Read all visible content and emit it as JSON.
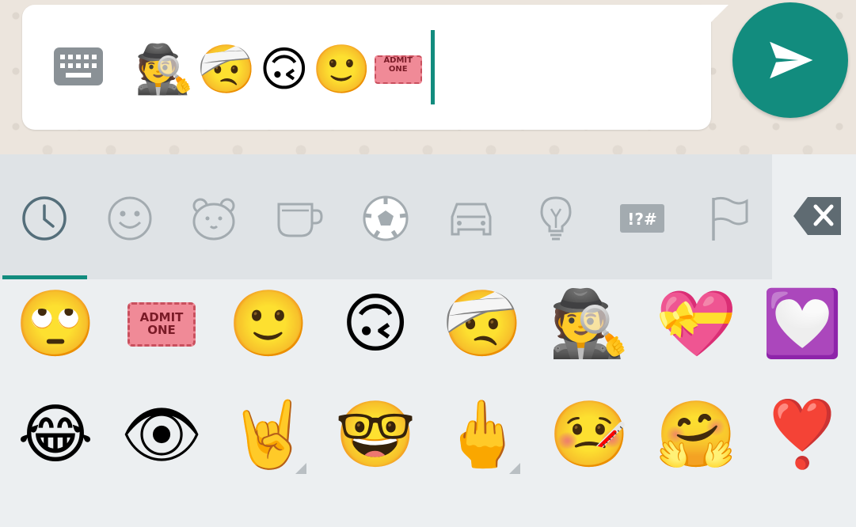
{
  "compose": {
    "typed_emojis": [
      "🕵️",
      "🤕",
      "🙃",
      "🙂"
    ],
    "ticket_text": "ADMIT ONE",
    "keyboard_toggle_icon": "keyboard-icon",
    "send_icon": "send-icon"
  },
  "tabs": [
    {
      "name": "recent",
      "icon": "clock-icon",
      "active": true
    },
    {
      "name": "smileys",
      "icon": "smiley-icon",
      "active": false
    },
    {
      "name": "animals",
      "icon": "bear-icon",
      "active": false
    },
    {
      "name": "food",
      "icon": "cup-icon",
      "active": false
    },
    {
      "name": "activities",
      "icon": "soccer-ball-icon",
      "active": false
    },
    {
      "name": "travel",
      "icon": "car-icon",
      "active": false
    },
    {
      "name": "objects",
      "icon": "lightbulb-icon",
      "active": false
    },
    {
      "name": "symbols",
      "icon": "symbols-icon",
      "label": "!?#",
      "active": false
    },
    {
      "name": "flags",
      "icon": "flag-icon",
      "active": false
    }
  ],
  "grid": {
    "row1": [
      "🙄",
      "ADMIT ONE",
      "🙂",
      "🙃",
      "🤕",
      "🕵️",
      "💝",
      "💟"
    ],
    "row2": [
      "😂",
      "👁",
      "🤘",
      "🤓",
      "🖕",
      "🤒",
      "🤗",
      "❣️"
    ]
  },
  "colors": {
    "accent": "#128c7e",
    "chat_background": "#ece5dd",
    "tabbar_background": "#dfe3e6",
    "keyboard_background": "#eceff1"
  }
}
